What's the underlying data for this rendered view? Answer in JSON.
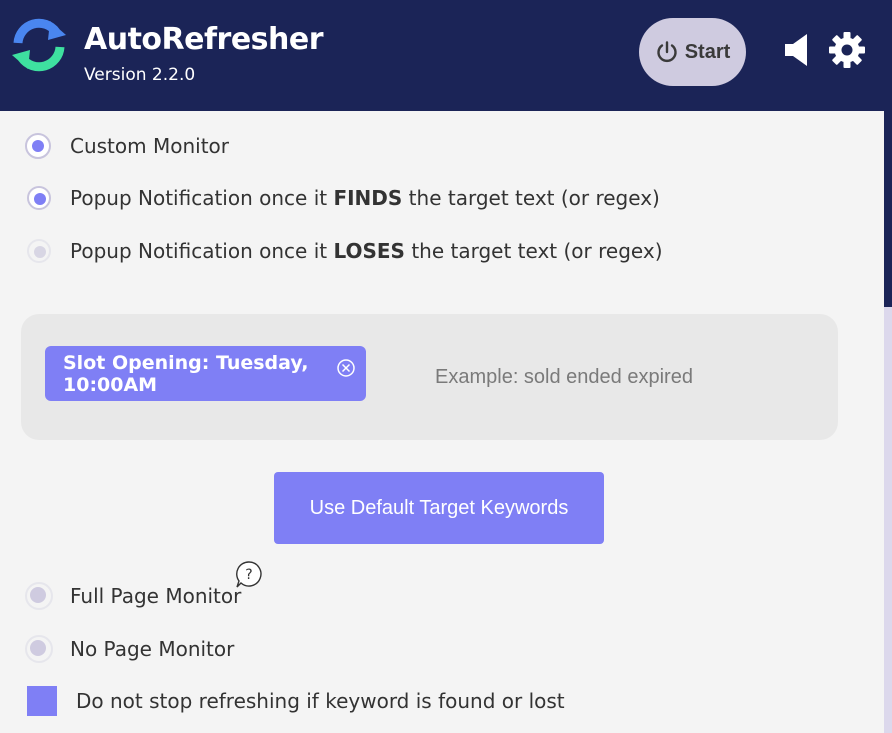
{
  "header": {
    "title": "AutoRefresher",
    "version": "Version 2.2.0",
    "start_label": "Start",
    "icons": [
      "refresh-logo-icon",
      "power-icon",
      "speaker-icon",
      "gear-icon"
    ]
  },
  "monitor_options": {
    "custom_monitor": "Custom Monitor",
    "find_prefix": "Popup Notification once it ",
    "find_bold": "FINDS",
    "find_suffix": " the target text (or regex)",
    "lose_prefix": "Popup Notification once it ",
    "lose_bold": "LOSES",
    "lose_suffix": " the target text (or regex)"
  },
  "keywords": {
    "tags": [
      "Slot Opening: Tuesday, 10:00AM"
    ],
    "placeholder": "Example: sold ended expired",
    "default_button": "Use Default Target Keywords"
  },
  "page_options": {
    "full_page": "Full Page Monitor",
    "no_page": "No Page Monitor"
  },
  "checkbox": {
    "label": "Do not stop refreshing if keyword is found or lost",
    "checked": true
  },
  "colors": {
    "header_bg": "#1b2457",
    "accent": "#7f7ff5",
    "start_bg": "#cfcbe0",
    "logo_blue": "#4a86f0",
    "logo_green": "#3ee0a0"
  }
}
